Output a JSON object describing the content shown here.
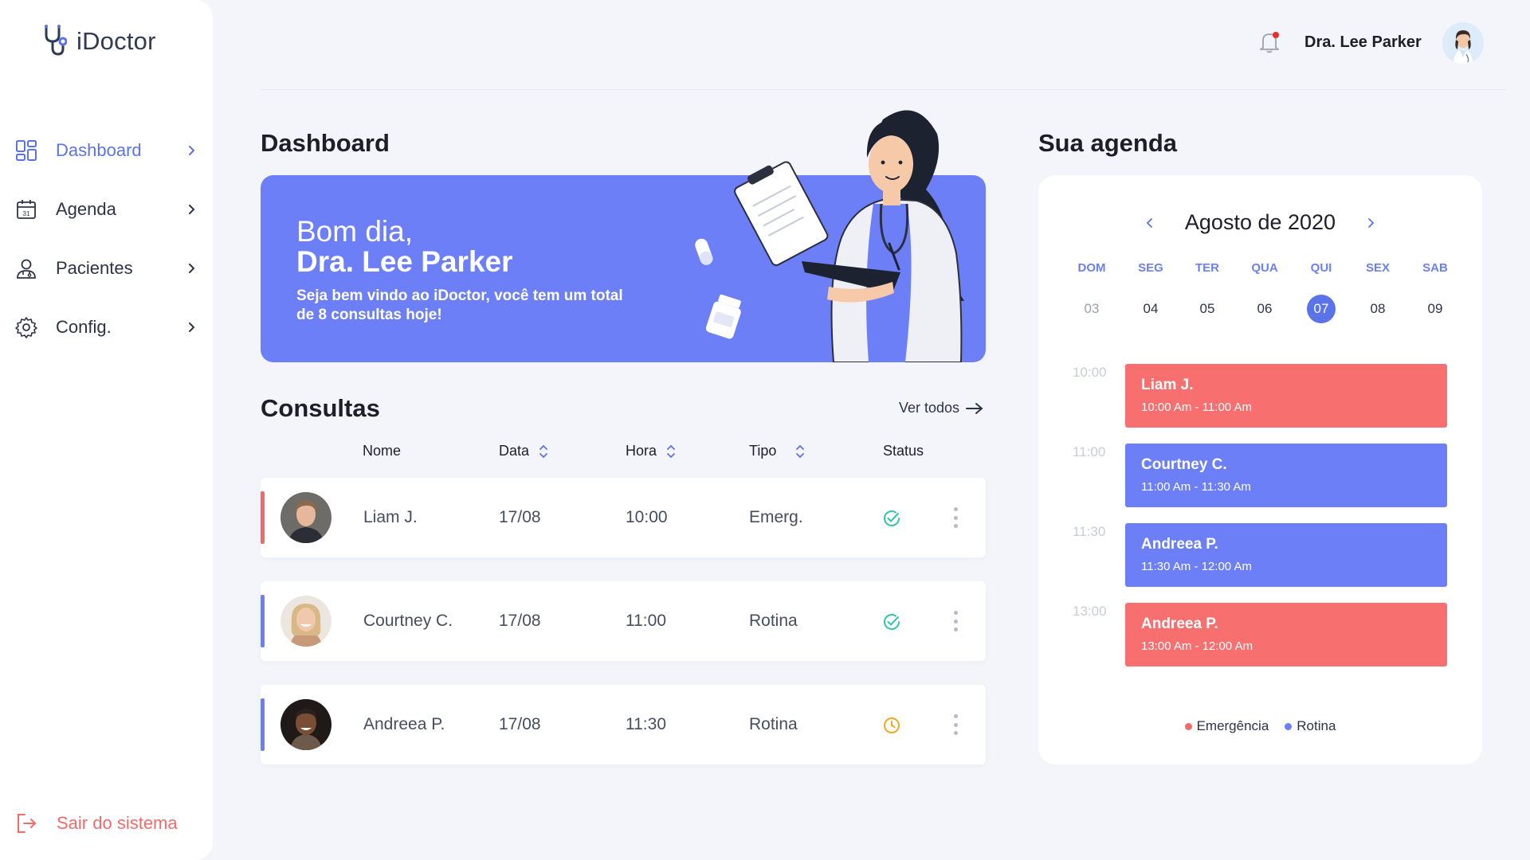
{
  "app": {
    "name": "iDoctor"
  },
  "sidebar": {
    "items": [
      {
        "label": "Dashboard",
        "icon": "dashboard-icon"
      },
      {
        "label": "Agenda",
        "icon": "calendar-icon"
      },
      {
        "label": "Pacientes",
        "icon": "patient-icon"
      },
      {
        "label": "Config.",
        "icon": "gear-icon"
      }
    ],
    "logout_label": "Sair do sistema"
  },
  "header": {
    "user_name": "Dra. Lee Parker",
    "has_notification": true
  },
  "main": {
    "title": "Dashboard",
    "banner": {
      "greeting": "Bom dia,",
      "name": "Dra. Lee Parker",
      "message": "Seja bem vindo ao iDoctor, você tem um total de 8 consultas hoje!"
    },
    "consultas": {
      "title": "Consultas",
      "see_all": "Ver todos",
      "columns": {
        "nome": "Nome",
        "data": "Data",
        "hora": "Hora",
        "tipo": "Tipo",
        "status": "Status"
      },
      "rows": [
        {
          "name": "Liam J.",
          "date": "17/08",
          "time": "10:00",
          "type": "Emerg.",
          "status": "confirmed",
          "color": "#f26b6b"
        },
        {
          "name": "Courtney C.",
          "date": "17/08",
          "time": "11:00",
          "type": "Rotina",
          "status": "confirmed",
          "color": "#6c7ff7"
        },
        {
          "name": "Andreea P.",
          "date": "17/08",
          "time": "11:30",
          "type": "Rotina",
          "status": "pending",
          "color": "#6c7ff7"
        }
      ]
    }
  },
  "agenda": {
    "title": "Sua agenda",
    "month": "Agosto de 2020",
    "weekdays": [
      "DOM",
      "SEG",
      "TER",
      "QUA",
      "QUI",
      "SEX",
      "SAB"
    ],
    "days": [
      "03",
      "04",
      "05",
      "06",
      "07",
      "08",
      "09"
    ],
    "selected_day": "07",
    "times": [
      "10:00",
      "11:00",
      "11:30",
      "13:00"
    ],
    "events": [
      {
        "name": "Liam J.",
        "time": "10:00 Am - 11:00 Am",
        "color": "#f76f6f"
      },
      {
        "name": "Courtney C.",
        "time": "11:00 Am - 11:30 Am",
        "color": "#6c7ff7"
      },
      {
        "name": "Andreea P.",
        "time": "11:30 Am - 12:00 Am",
        "color": "#6c7ff7"
      },
      {
        "name": "Andreea P.",
        "time": "13:00 Am - 12:00 Am",
        "color": "#f76f6f"
      }
    ],
    "legend": [
      {
        "label": "Emergência",
        "color": "#f26b6b"
      },
      {
        "label": "Rotina",
        "color": "#6c7ff7"
      }
    ]
  },
  "colors": {
    "accent": "#5b73e8",
    "banner": "#6c7ff7",
    "emergency": "#f26b6b",
    "confirmed": "#32c5a8",
    "pending": "#f5a623"
  }
}
